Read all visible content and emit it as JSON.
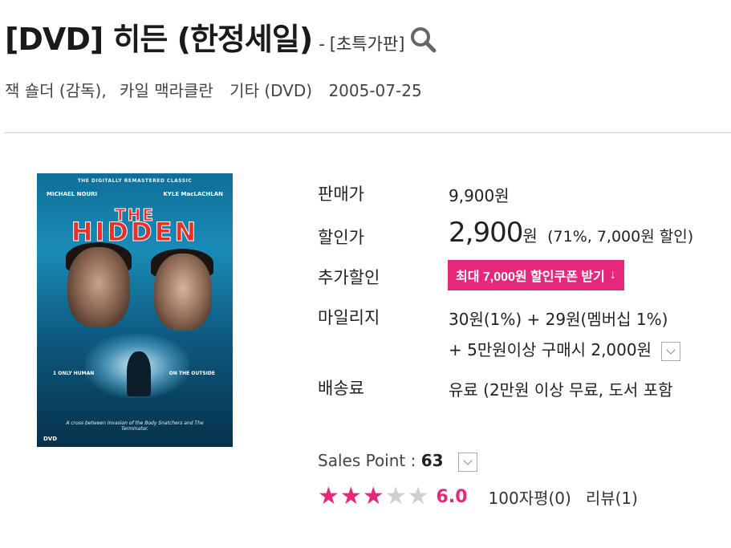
{
  "product": {
    "title": "[DVD] 히든 (한정세일)",
    "separator": "-",
    "edition": "[초특가판]"
  },
  "meta": {
    "director": "잭 숄더 (감독),",
    "actor": "카일 맥라클란",
    "format": "기타 (DVD)",
    "release_date": "2005-07-25"
  },
  "cover": {
    "topline": "THE DIGITALLY REMASTERED CLASSIC",
    "actor_left": "MICHAEL NOURI",
    "actor_right": "KYLE MacLACHLAN",
    "title_the": "THE",
    "title_main": "HIDDEN",
    "tag_left": "1 ONLY HUMAN",
    "tag_right": "ON THE OUTSIDE",
    "quote": "A cross between Invasion of the Body Snatchers and The Terminator.",
    "logo": "DVD"
  },
  "pricing": {
    "list_price_label": "판매가",
    "list_price": "9,900원",
    "sale_price_label": "할인가",
    "sale_price": "2,900",
    "sale_unit": "원",
    "discount_note": "(71%, 7,000원 할인)",
    "extra_discount_label": "추가할인",
    "coupon_button": "최대 7,000원 할인쿠폰 받기",
    "coupon_arrow": "↓",
    "mileage_label": "마일리지",
    "mileage_line1": "30원(1%) + 29원(멤버십 1%)",
    "mileage_line2": "+ 5만원이상 구매시 2,000원",
    "shipping_label": "배송료",
    "shipping_value": "유료 (2만원 이상 무료, 도서 포함"
  },
  "sales": {
    "label": "Sales Point : ",
    "value": "63"
  },
  "rating": {
    "stars_filled": 3,
    "stars_total": 5,
    "score": "6.0",
    "reviews_100": "100자평(0)",
    "reviews": "리뷰(1)"
  },
  "colors": {
    "accent": "#e4287b",
    "star_off": "#cfcfcf"
  }
}
